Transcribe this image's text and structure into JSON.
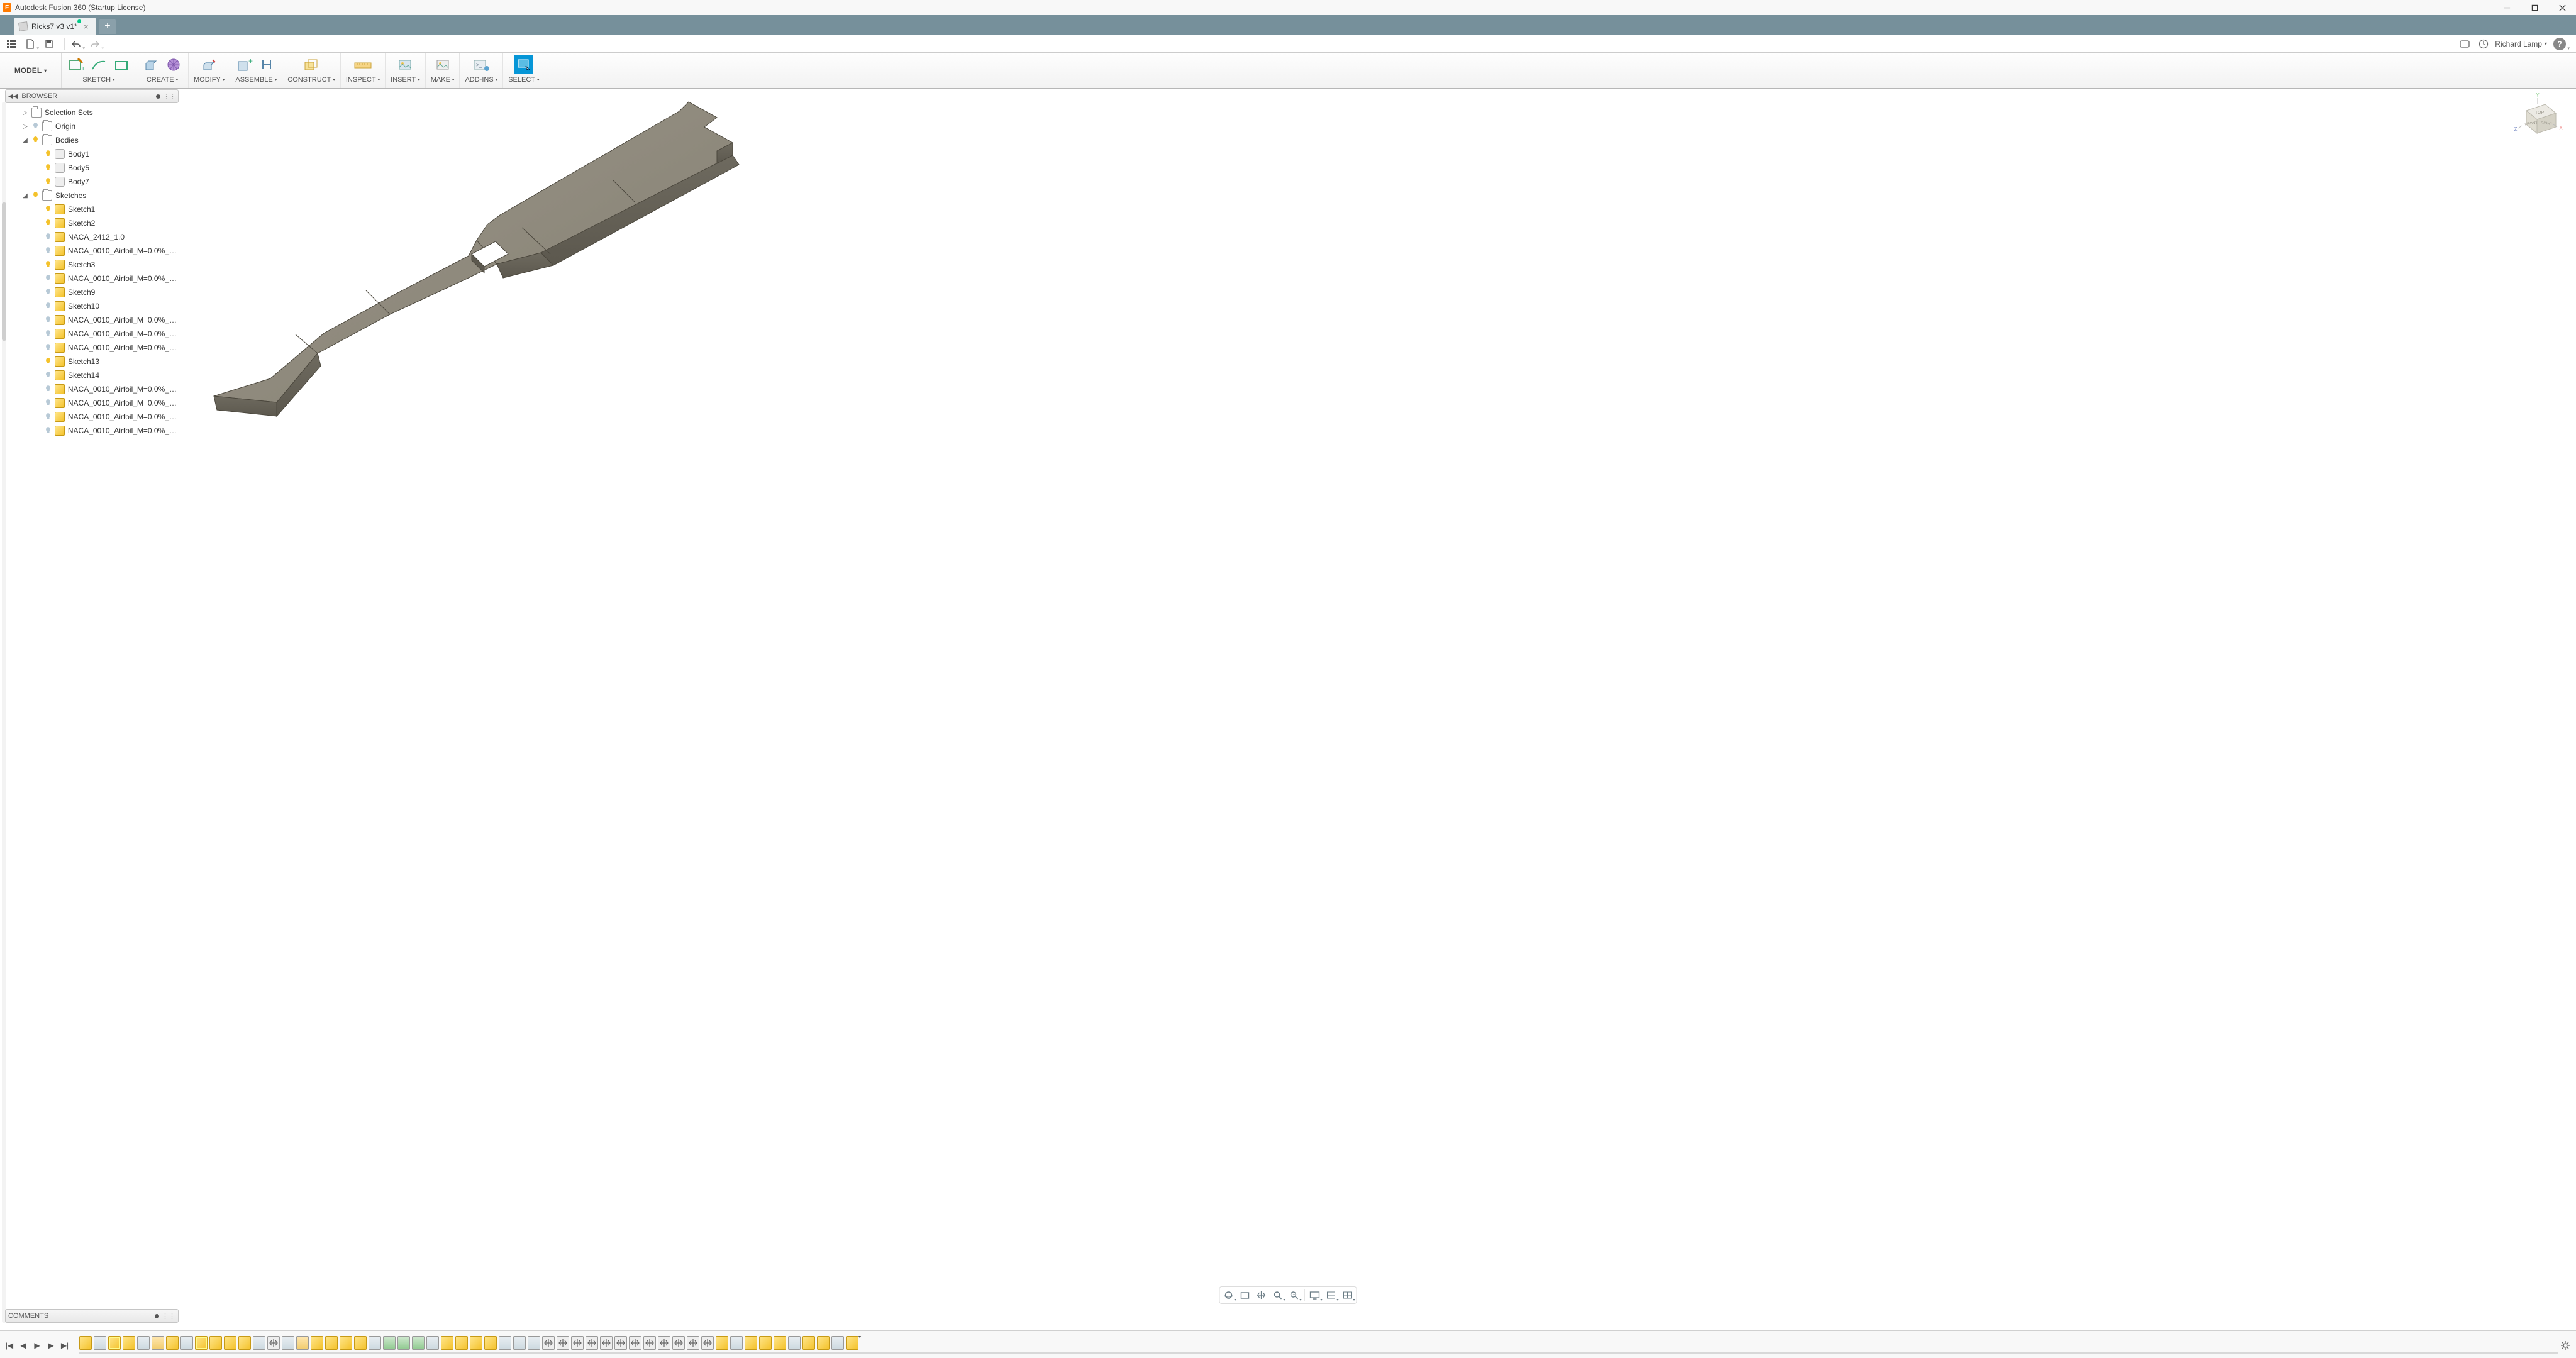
{
  "app": {
    "title": "Autodesk Fusion 360 (Startup License)"
  },
  "tab": {
    "name": "Ricks7 v3 v1*"
  },
  "user": {
    "name": "Richard Lamp"
  },
  "workspace": {
    "label": "MODEL"
  },
  "ribbon": {
    "sketch": "SKETCH",
    "create": "CREATE",
    "modify": "MODIFY",
    "assemble": "ASSEMBLE",
    "construct": "CONSTRUCT",
    "inspect": "INSPECT",
    "insert": "INSERT",
    "make": "MAKE",
    "addins": "ADD-INS",
    "select": "SELECT"
  },
  "panels": {
    "browser": "BROWSER",
    "comments": "COMMENTS"
  },
  "tree": {
    "selection_sets": "Selection Sets",
    "origin": "Origin",
    "bodies": "Bodies",
    "body1": "Body1",
    "body5": "Body5",
    "body7": "Body7",
    "sketches": "Sketches",
    "items": [
      "Sketch1",
      "Sketch2",
      "NACA_2412_1.0",
      "NACA_0010_Airfoil_M=0.0%_F...",
      "Sketch3",
      "NACA_0010_Airfoil_M=0.0%_F...",
      "Sketch9",
      "Sketch10",
      "NACA_0010_Airfoil_M=0.0%_F...",
      "NACA_0010_Airfoil_M=0.0%_F...",
      "NACA_0010_Airfoil_M=0.0%_F...",
      "Sketch13",
      "Sketch14",
      "NACA_0010_Airfoil_M=0.0%_F...",
      "NACA_0010_Airfoil_M=0.0%_F...",
      "NACA_0010_Airfoil_M=0.0%_F...",
      "NACA_0010_Airfoil_M=0.0%_F..."
    ],
    "bulbs": [
      "on",
      "on",
      "off",
      "off",
      "on",
      "off",
      "off",
      "off",
      "off",
      "off",
      "off",
      "on",
      "off",
      "off",
      "off",
      "off",
      "off"
    ]
  },
  "viewcube": {
    "top": "TOP",
    "front": "FRONT",
    "right": "RIGHT",
    "x": "X",
    "y": "Y",
    "z": "Z"
  },
  "timeline": {
    "features": [
      "sketch",
      "ext",
      "sketch hl",
      "sketch",
      "ext",
      "plane",
      "sketch",
      "ext",
      "sketch hl",
      "sketch",
      "sketch",
      "sketch",
      "ext",
      "move",
      "ext",
      "plane",
      "sketch",
      "sketch",
      "sketch",
      "sketch",
      "ext",
      "loft",
      "loft",
      "loft",
      "ext",
      "sketch",
      "sketch",
      "sketch",
      "sketch",
      "ext",
      "ext",
      "ext",
      "move",
      "move",
      "move",
      "move",
      "move",
      "move",
      "move",
      "move",
      "move",
      "move",
      "move",
      "move",
      "sketch",
      "ext",
      "sketch",
      "sketch",
      "sketch",
      "ext",
      "sketch",
      "sketch",
      "ext",
      "sketch"
    ]
  }
}
